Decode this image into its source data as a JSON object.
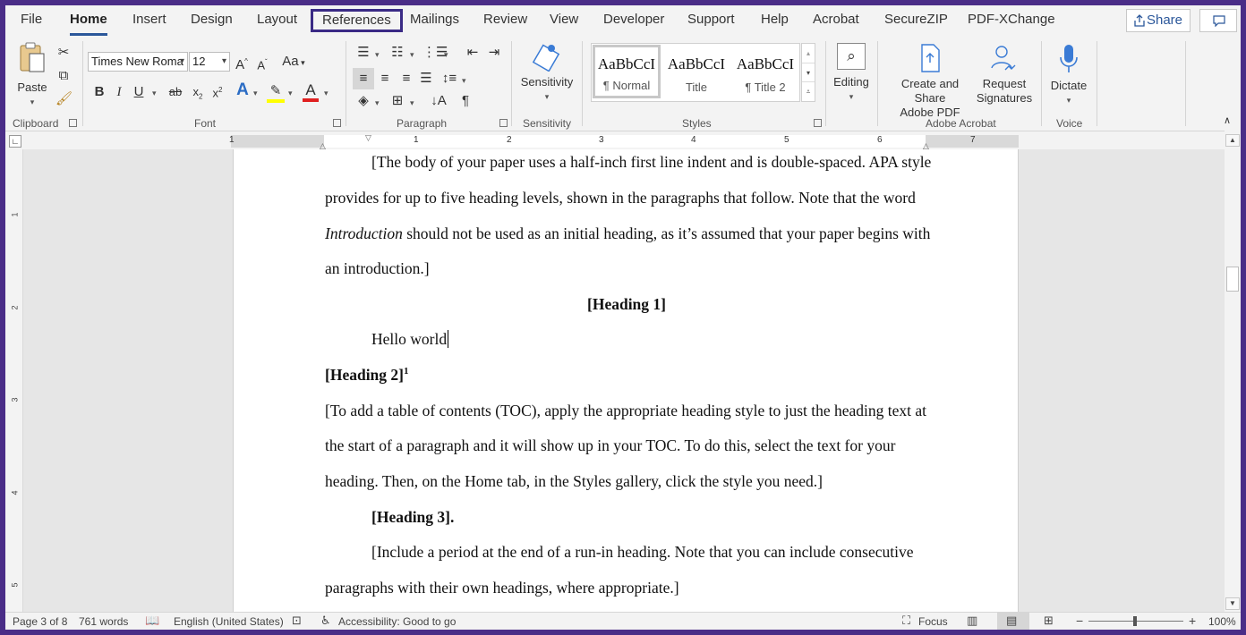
{
  "tabs": [
    "File",
    "Home",
    "Insert",
    "Design",
    "Layout",
    "References",
    "Mailings",
    "Review",
    "View",
    "Developer",
    "Support",
    "Help",
    "Acrobat",
    "SecureZIP",
    "PDF-XChange"
  ],
  "active_tab": "Home",
  "highlighted_tab": "References",
  "share_label": "Share",
  "clipboard": {
    "paste_label": "Paste",
    "group": "Clipboard"
  },
  "font": {
    "name": "Times New Roma",
    "size": "12",
    "group": "Font",
    "change_case": "Aa"
  },
  "paragraph": {
    "group": "Paragraph"
  },
  "sensitivity": {
    "label": "Sensitivity",
    "group": "Sensitivity"
  },
  "styles": {
    "group": "Styles",
    "items": [
      {
        "preview": "AaBbCcI",
        "name": "¶ Normal"
      },
      {
        "preview": "AaBbCcI",
        "name": "Title"
      },
      {
        "preview": "AaBbCcI",
        "name": "¶ Title 2"
      }
    ]
  },
  "editing": {
    "label": "Editing"
  },
  "acrobat": {
    "create_share_line1": "Create and Share",
    "create_share_line2": "Adobe PDF",
    "request_line1": "Request",
    "request_line2": "Signatures",
    "group": "Adobe Acrobat"
  },
  "voice": {
    "dictate": "Dictate",
    "group": "Voice"
  },
  "ruler_numbers": [
    "1",
    "1",
    "2",
    "3",
    "4",
    "5",
    "6",
    "7"
  ],
  "vruler_numbers": [
    "1",
    "2",
    "3",
    "4",
    "5"
  ],
  "document": {
    "lines": [
      "[The body of your paper uses a half-inch first line indent and is double-spaced.  APA style",
      "provides for up to five heading levels, shown in the paragraphs that follow.  Note that the word",
      "should not be used as an initial heading, as it’s assumed that your paper begins with",
      "an introduction.]",
      "[Heading 1]",
      "Hello world",
      "[Heading 2]",
      "[To add a table of contents (TOC), apply the appropriate heading style to just the heading text at",
      "the start of a paragraph and it will show up in your TOC.  To do this, select the text for your",
      "heading.  Then, on the Home tab, in the Styles gallery, click the style you need.]",
      "[Heading 3].",
      "[Include a period at the end of a run-in heading.  Note that you can include consecutive",
      "paragraphs with their own headings, where appropriate.]"
    ],
    "italic_word": "Introduction",
    "footnote_ref": "1"
  },
  "status": {
    "page": "Page 3 of 8",
    "words": "761 words",
    "language": "English (United States)",
    "accessibility": "Accessibility: Good to go",
    "focus": "Focus",
    "zoom": "100%"
  },
  "colors": {
    "accent": "#2b579a",
    "frame": "#4a2d87",
    "highlight": "#ffff00",
    "font_color": "#e02020"
  }
}
